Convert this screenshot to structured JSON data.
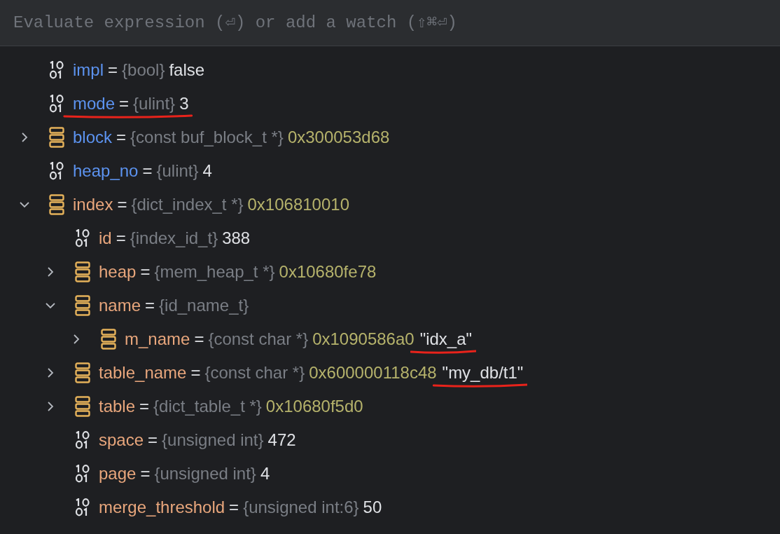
{
  "evaluate_field": {
    "placeholder": "Evaluate expression (⏎) or add a watch (⇧⌘⏎)"
  },
  "variables": [
    {
      "kind": "primitive",
      "name": "impl",
      "color": "#5c93f0",
      "sep": "=",
      "type": "{bool}",
      "value": "false"
    },
    {
      "kind": "primitive",
      "name": "mode",
      "color": "#5c93f0",
      "sep": "=",
      "type": "{ulint}",
      "value": "3",
      "underlined": true
    },
    {
      "kind": "struct",
      "name": "block",
      "color": "#5c93f0",
      "sep": "=",
      "type": "{const buf_block_t *}",
      "address": "0x300053d68",
      "expanded": false
    },
    {
      "kind": "primitive",
      "name": "heap_no",
      "color": "#5c93f0",
      "sep": "=",
      "type": "{ulint}",
      "value": "4"
    },
    {
      "kind": "struct",
      "name": "index",
      "color": "#e8a67c",
      "sep": "=",
      "type": "{dict_index_t *}",
      "address": "0x106810010",
      "expanded": true,
      "children": [
        {
          "kind": "primitive",
          "name": "id",
          "color": "#e8a67c",
          "sep": "=",
          "type": "{index_id_t}",
          "value": "388"
        },
        {
          "kind": "struct",
          "name": "heap",
          "color": "#e8a67c",
          "sep": "=",
          "type": "{mem_heap_t *}",
          "address": "0x10680fe78",
          "expanded": false
        },
        {
          "kind": "struct",
          "name": "name",
          "color": "#e8a67c",
          "sep": "=",
          "type": "{id_name_t}",
          "expanded": true,
          "children": [
            {
              "kind": "struct",
              "name": "m_name",
              "color": "#e8a67c",
              "sep": "=",
              "type": "{const char *}",
              "address": "0x1090586a0",
              "string": "\"idx_a\"",
              "expanded": false,
              "underlined": true
            }
          ]
        },
        {
          "kind": "struct",
          "name": "table_name",
          "color": "#e8a67c",
          "sep": "=",
          "type": "{const char *}",
          "address": "0x600000118c48",
          "string": "\"my_db/t1\"",
          "expanded": false,
          "underlined": true
        },
        {
          "kind": "struct",
          "name": "table",
          "color": "#e8a67c",
          "sep": "=",
          "type": "{dict_table_t *}",
          "address": "0x10680f5d0",
          "expanded": false
        },
        {
          "kind": "primitive",
          "name": "space",
          "color": "#e8a67c",
          "sep": "=",
          "type": "{unsigned int}",
          "value": "472"
        },
        {
          "kind": "primitive",
          "name": "page",
          "color": "#e8a67c",
          "sep": "=",
          "type": "{unsigned int}",
          "value": "4"
        },
        {
          "kind": "primitive",
          "name": "merge_threshold",
          "color": "#e8a67c",
          "sep": "=",
          "type": "{unsigned int:6}",
          "value": "50"
        }
      ]
    }
  ]
}
